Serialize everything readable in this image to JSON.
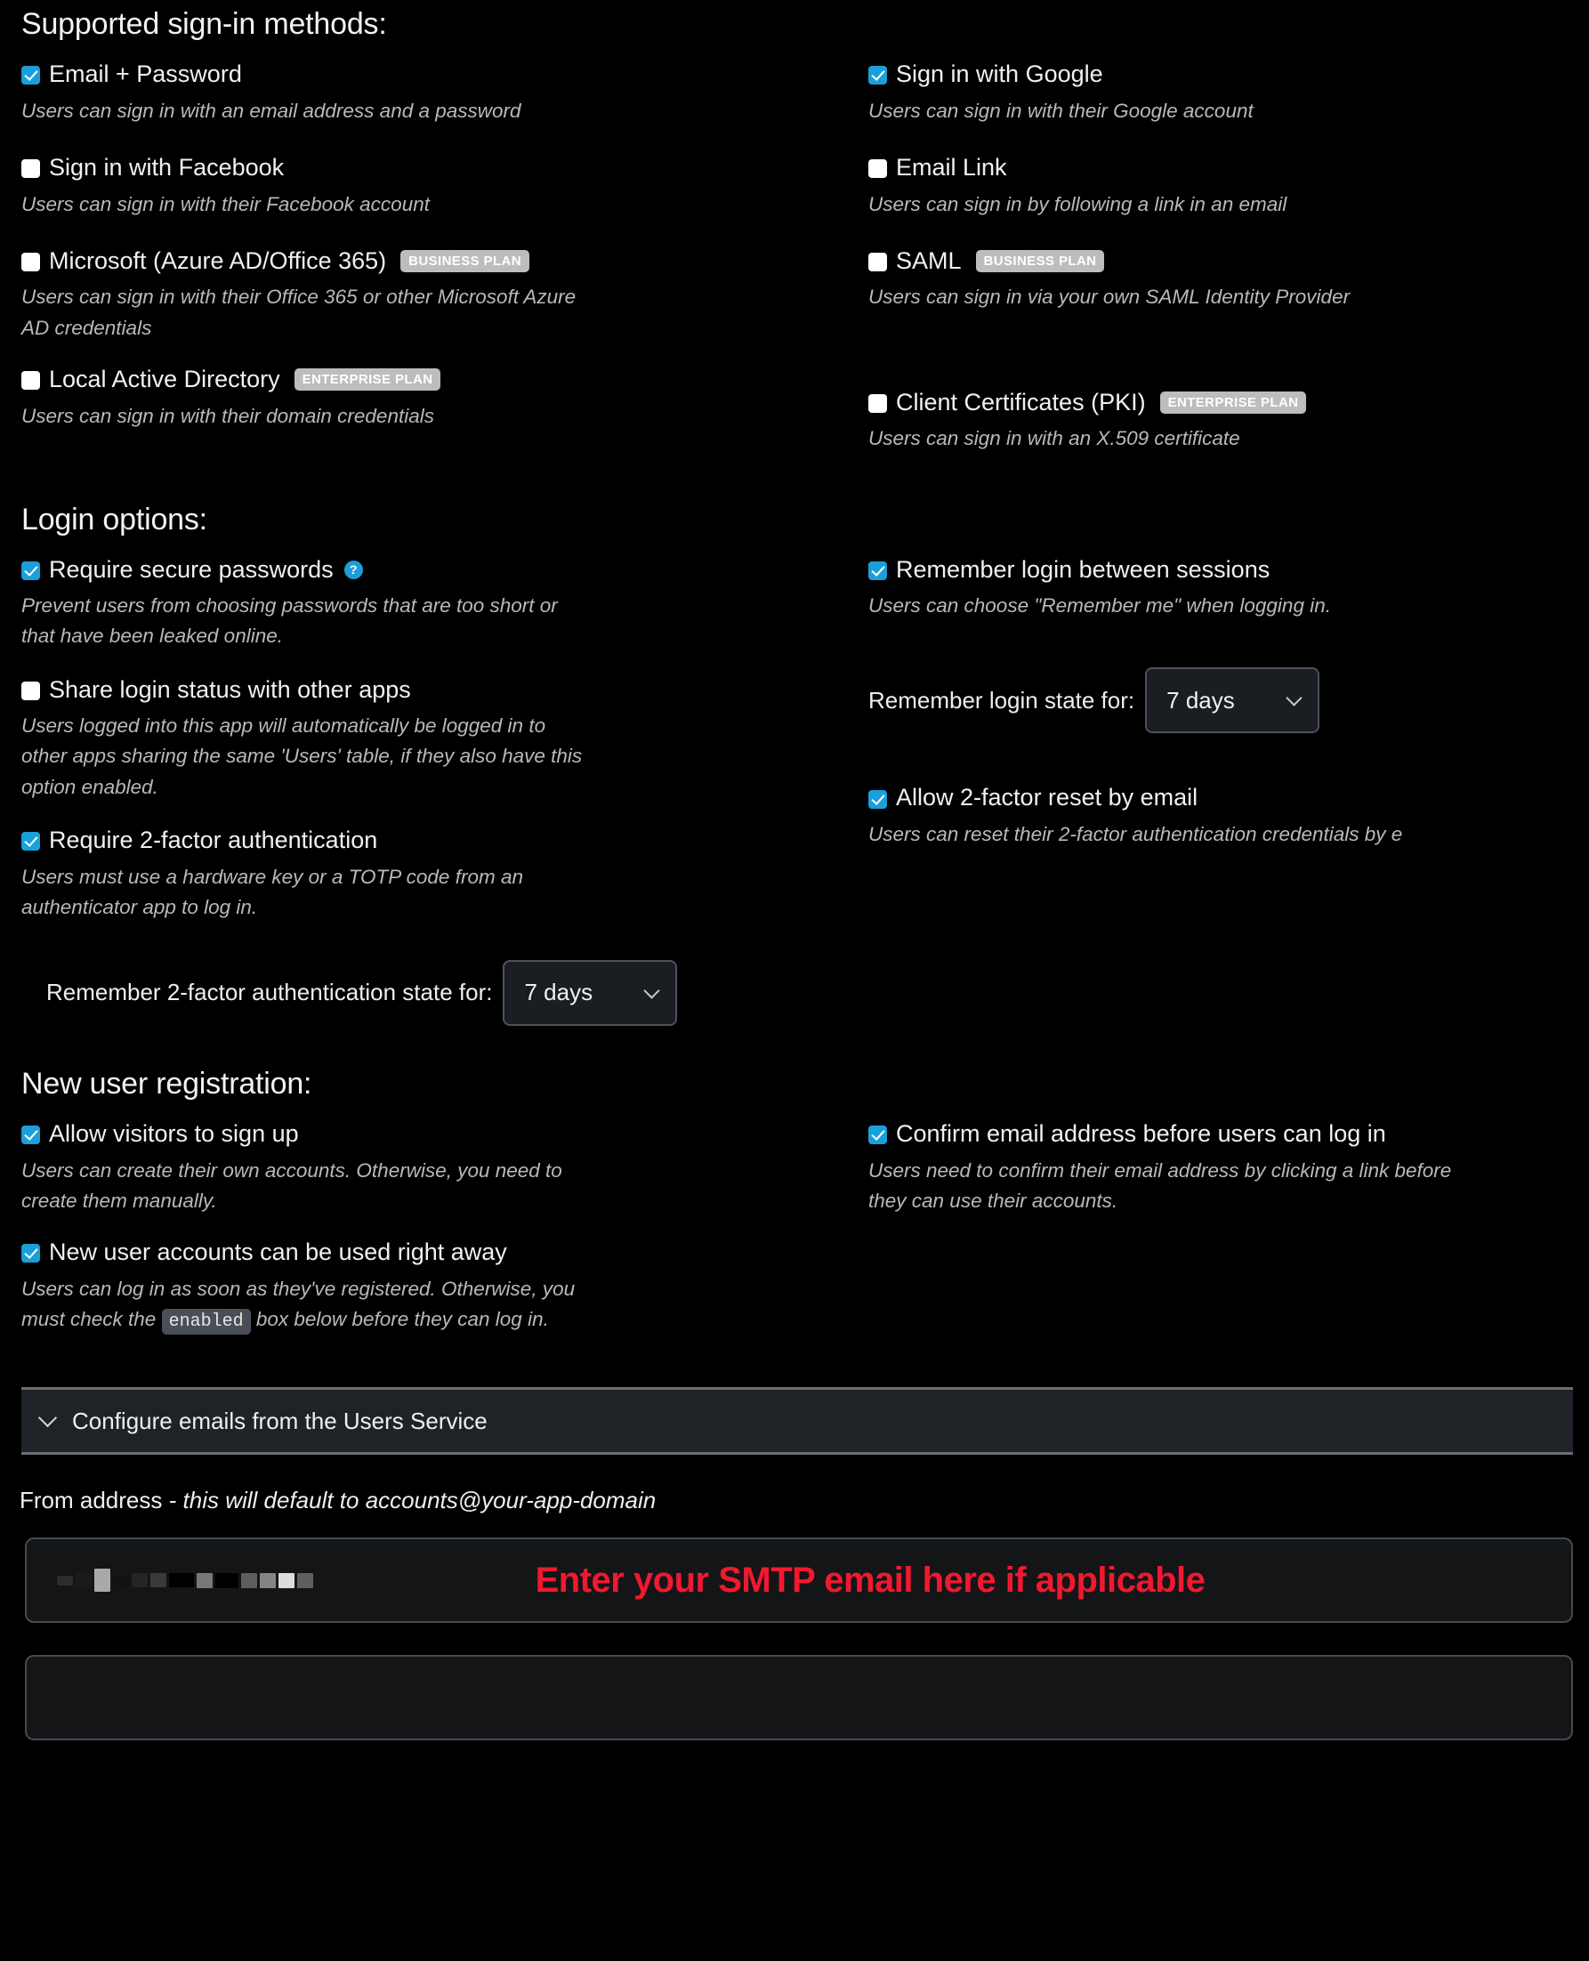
{
  "sections": {
    "signin": {
      "title": "Supported sign-in methods:",
      "left": [
        {
          "label": "Email + Password",
          "checked": true,
          "badge": "",
          "desc": "Users can sign in with an email address and a password"
        },
        {
          "label": "Sign in with Facebook",
          "checked": false,
          "badge": "",
          "desc": "Users can sign in with their Facebook account"
        },
        {
          "label": "Microsoft (Azure AD/Office 365)",
          "checked": false,
          "badge": "BUSINESS PLAN",
          "desc": "Users can sign in with their Office 365 or other Microsoft Azure AD credentials"
        },
        {
          "label": "Local Active Directory",
          "checked": false,
          "badge": "ENTERPRISE PLAN",
          "desc": "Users can sign in with their domain credentials"
        }
      ],
      "right": [
        {
          "label": "Sign in with Google",
          "checked": true,
          "badge": "",
          "desc": "Users can sign in with their Google account"
        },
        {
          "label": "Email Link",
          "checked": false,
          "badge": "",
          "desc": "Users can sign in by following a link in an email"
        },
        {
          "label": "SAML",
          "checked": false,
          "badge": "BUSINESS PLAN",
          "desc": "Users can sign in via your own SAML Identity Provider"
        },
        {
          "label": "Client Certificates (PKI)",
          "checked": false,
          "badge": "ENTERPRISE PLAN",
          "desc": "Users can sign in with an X.509 certificate"
        }
      ]
    },
    "login_options": {
      "title": "Login options:",
      "secure_passwords": {
        "label": "Require secure passwords",
        "checked": true,
        "help_icon": "question-mark-icon",
        "desc": "Prevent users from choosing passwords that are too short or that have been leaked online."
      },
      "share_login": {
        "label": "Share login status with other apps",
        "checked": false,
        "desc": "Users logged into this app will automatically be logged in to other apps sharing the same 'Users' table, if they also have this option enabled."
      },
      "require_2fa": {
        "label": "Require 2-factor authentication",
        "checked": true,
        "desc": "Users must use a hardware key or a TOTP code from an authenticator app to log in."
      },
      "remember_login": {
        "label": "Remember login between sessions",
        "checked": true,
        "desc": "Users can choose \"Remember me\" when logging in."
      },
      "allow_2fa_reset": {
        "label": "Allow 2-factor reset by email",
        "checked": true,
        "desc": "Users can reset their 2-factor authentication credentials by e"
      },
      "remember_login_state": {
        "label": "Remember login state for:",
        "value": "7 days"
      },
      "remember_2fa_state": {
        "label": "Remember 2-factor authentication state for:",
        "value": "7 days"
      }
    },
    "registration": {
      "title": "New user registration:",
      "allow_signup": {
        "label": "Allow visitors to sign up",
        "checked": true,
        "desc": "Users can create their own accounts. Otherwise, you need to create them manually."
      },
      "use_right_away": {
        "label": "New user accounts can be used right away",
        "checked": true,
        "desc_before": "Users can log in as soon as they've registered. Otherwise, you must check the",
        "desc_code": "enabled",
        "desc_after": "box below before they can log in."
      },
      "confirm_email": {
        "label": "Confirm email address before users can log in",
        "checked": true,
        "desc": "Users need to confirm their email address by clicking a link before they can use their accounts."
      }
    },
    "emails": {
      "collapse_label": "Configure emails from the Users Service",
      "chevron_icon": "chevron-down-icon",
      "from_label": "From address",
      "from_note": "- this will default to accounts@your-app-domain",
      "from_value": "",
      "annotation": "Enter your SMTP email here if applicable"
    }
  },
  "colors": {
    "accent": "#1b9fd8",
    "badge_bg": "#bdbdbd",
    "annotation": "#f2182f",
    "background": "#000000"
  }
}
